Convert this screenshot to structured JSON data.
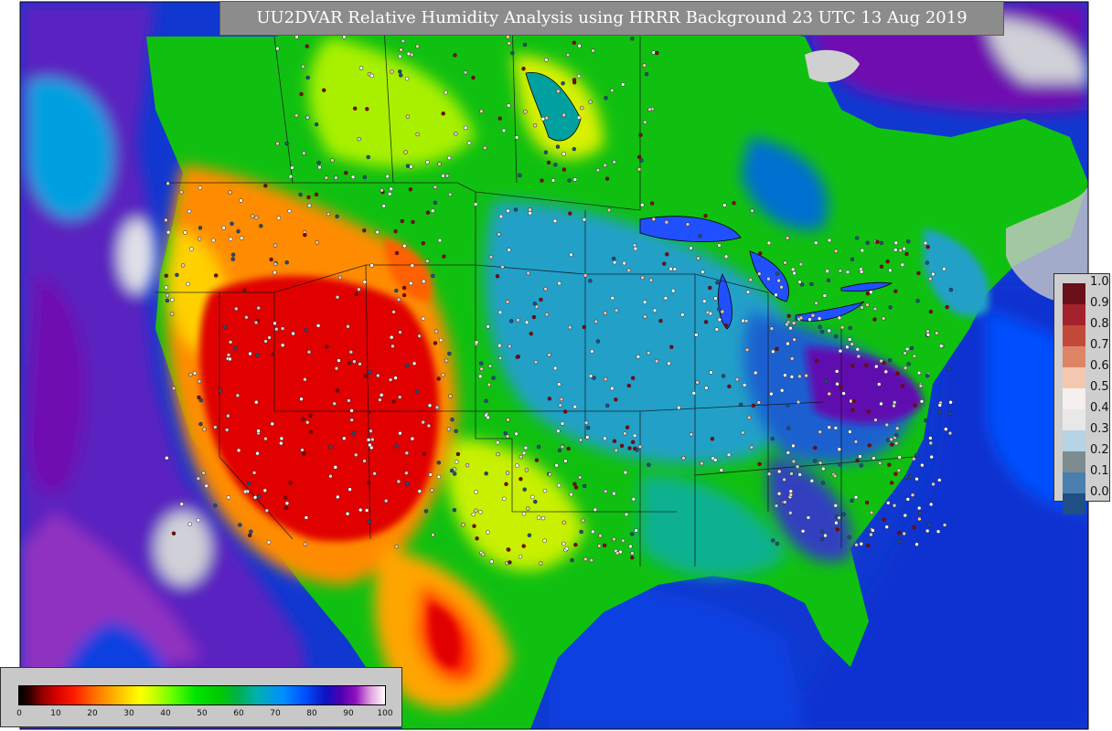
{
  "title": "UU2DVAR Relative Humidity Analysis using HRRR Background 23 UTC 13 Aug 2019",
  "station_legend": {
    "ticks": [
      "1.0",
      "0.9",
      "0.8",
      "0.7",
      "0.6",
      "0.5",
      "0.4",
      "0.3",
      "0.2",
      "0.1",
      "0.0"
    ],
    "colors": [
      "#6b0f1a",
      "#a3222e",
      "#c34a3a",
      "#dd8466",
      "#f4c7b0",
      "#f5f0ee",
      "#e8e8e8",
      "#b6d4e3",
      "#7d8c8f",
      "#4a7fb0",
      "#1f4f85"
    ]
  },
  "rh_colorbar": {
    "ticks": [
      "0",
      "10",
      "20",
      "30",
      "40",
      "50",
      "60",
      "70",
      "80",
      "90",
      "100"
    ]
  },
  "colors": {
    "ocean_deep": "#1038d0",
    "ocean_purple": "#7a10c0",
    "dry_red": "#e00000",
    "moist_green": "#10c810",
    "cyan": "#00a8c8",
    "land_mask": "#c8c8c8"
  }
}
